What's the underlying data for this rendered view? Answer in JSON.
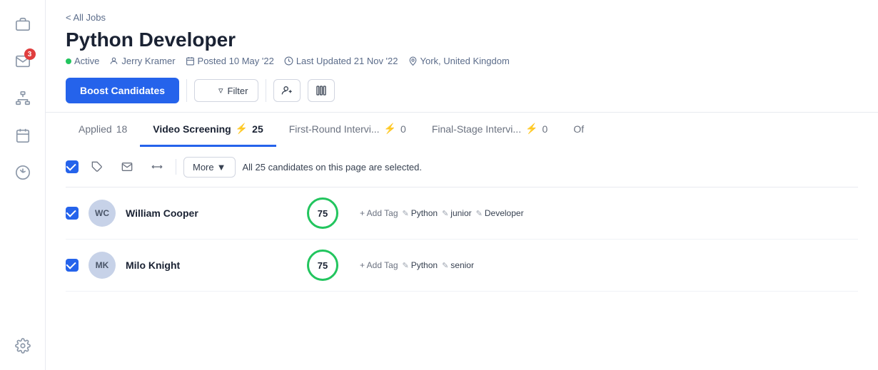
{
  "sidebar": {
    "items": [
      {
        "name": "briefcase-icon",
        "label": "Jobs",
        "badge": null
      },
      {
        "name": "inbox-icon",
        "label": "Inbox",
        "badge": "3"
      },
      {
        "name": "org-icon",
        "label": "Organization",
        "badge": null
      },
      {
        "name": "calendar-icon",
        "label": "Calendar",
        "badge": null
      },
      {
        "name": "chart-icon",
        "label": "Reports",
        "badge": null
      },
      {
        "name": "settings-icon",
        "label": "Settings",
        "badge": null
      }
    ]
  },
  "breadcrumb": "< All Jobs",
  "page_title": "Python Developer",
  "meta": {
    "status": "Active",
    "owner": "Jerry Kramer",
    "posted": "Posted 10 May '22",
    "updated": "Last Updated 21 Nov '22",
    "location": "York, United Kingdom"
  },
  "toolbar": {
    "boost_label": "Boost Candidates",
    "filter_label": "Filter",
    "add_icon_title": "Add Candidate",
    "settings_icon_title": "Column Settings"
  },
  "tabs": [
    {
      "label": "Applied",
      "count": "18",
      "lightning": false
    },
    {
      "label": "Video Screening",
      "count": "25",
      "lightning": true,
      "active": true
    },
    {
      "label": "First-Round Intervi...",
      "count": "0",
      "lightning": true
    },
    {
      "label": "Final-Stage Intervi...",
      "count": "0",
      "lightning": true
    },
    {
      "label": "Of",
      "count": "",
      "lightning": false
    }
  ],
  "bulk_bar": {
    "more_label": "More",
    "selection_msg": "All 25 candidates on this page are selected."
  },
  "candidates": [
    {
      "initials": "WC",
      "name": "William Cooper",
      "score": "75",
      "tags": [
        "Python",
        "junior",
        "Developer"
      ],
      "add_tag_label": "+ Add Tag"
    },
    {
      "initials": "MK",
      "name": "Milo Knight",
      "score": "75",
      "tags": [
        "Python",
        "senior"
      ],
      "add_tag_label": "+ Add Tag"
    }
  ],
  "colors": {
    "accent": "#2563eb",
    "active_status": "#22c55e",
    "lightning": "#f59e0b",
    "score_border": "#22c55e"
  }
}
